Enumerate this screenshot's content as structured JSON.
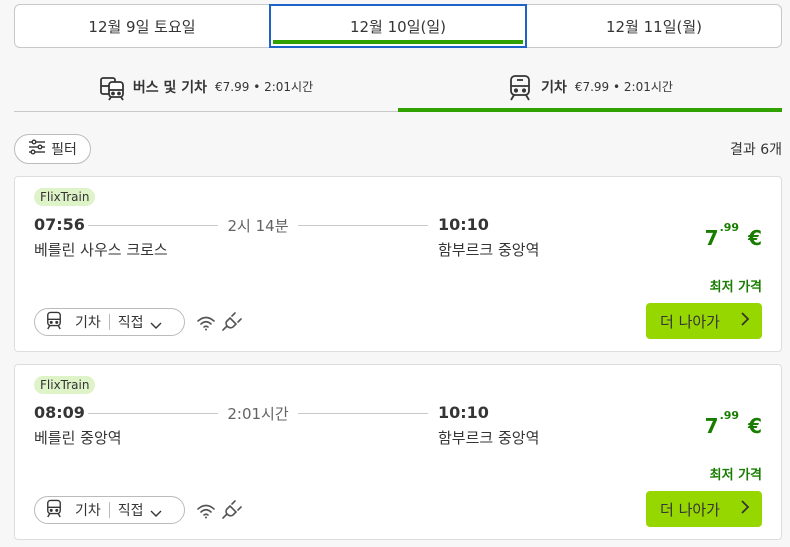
{
  "dates": [
    {
      "label": "12월 9일 토요일",
      "active": false
    },
    {
      "label": "12월 10일(일)",
      "active": true
    },
    {
      "label": "12월 11일(월)",
      "active": false
    }
  ],
  "modes": [
    {
      "label": "버스 및 기차",
      "meta": "€7.99 • 2:01시간",
      "icon": "bus-train-icon",
      "active": false
    },
    {
      "label": "기차",
      "meta": "€7.99 • 2:01시간",
      "icon": "train-icon",
      "active": true
    }
  ],
  "filter": {
    "label": "필터",
    "icon": "sliders-icon"
  },
  "result_count": "결과 6개",
  "colors": {
    "accent_green": "#31a100",
    "price_green": "#187d00",
    "button_green": "#97d700",
    "brand_badge": "#dff3c8",
    "focus_blue": "#1e64c8"
  },
  "results": [
    {
      "brand": "FlixTrain",
      "departure_time": "07:56",
      "departure_station": "베를린 사우스 크로스",
      "duration": "2시 14분",
      "arrival_time": "10:10",
      "arrival_station": "함부르크 중앙역",
      "price_int": "7",
      "price_dec": ".99",
      "currency": "€",
      "lowest_label": "최저 가격",
      "transport_label": "기차",
      "route_type": "직접",
      "continue_label": "더 나아가"
    },
    {
      "brand": "FlixTrain",
      "departure_time": "08:09",
      "departure_station": "베를린 중앙역",
      "duration": "2:01시간",
      "arrival_time": "10:10",
      "arrival_station": "함부르크 중앙역",
      "price_int": "7",
      "price_dec": ".99",
      "currency": "€",
      "lowest_label": "최저 가격",
      "transport_label": "기차",
      "route_type": "직접",
      "continue_label": "더 나아가"
    }
  ]
}
